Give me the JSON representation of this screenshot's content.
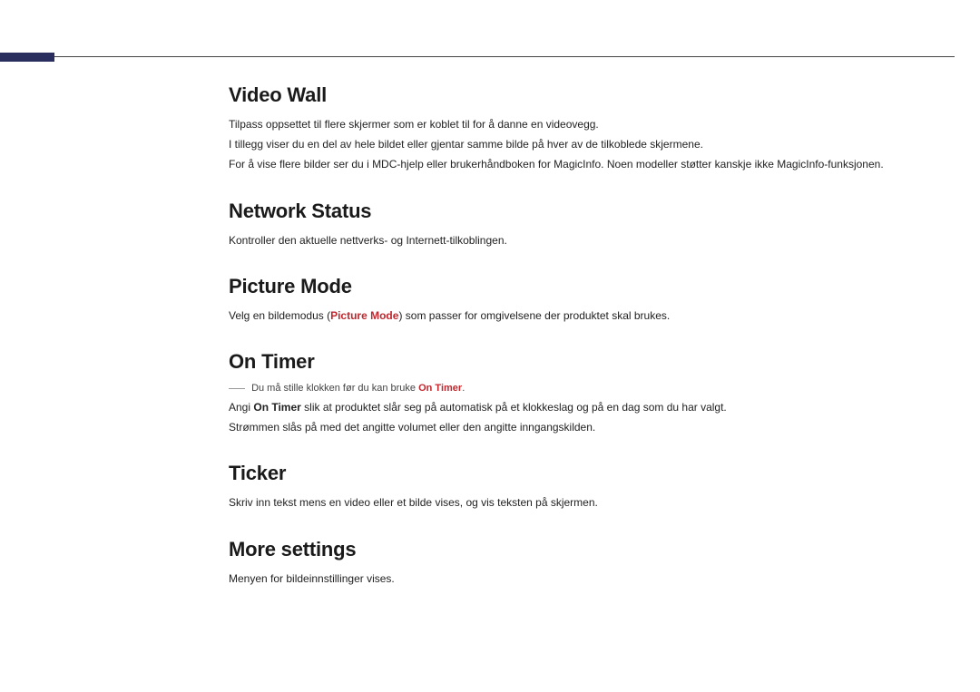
{
  "sections": {
    "videoWall": {
      "heading": "Video Wall",
      "p1": "Tilpass oppsettet til flere skjermer som er koblet til for å danne en videovegg.",
      "p2": "I tillegg viser du en del av hele bildet eller gjentar samme bilde på hver av de tilkoblede skjermene.",
      "p3": "For å vise flere bilder ser du i MDC-hjelp eller brukerhåndboken for MagicInfo. Noen modeller støtter kanskje ikke MagicInfo-funksjonen."
    },
    "networkStatus": {
      "heading": "Network Status",
      "p1": "Kontroller den aktuelle nettverks- og Internett-tilkoblingen."
    },
    "pictureMode": {
      "heading": "Picture Mode",
      "lead": "Velg en bildemodus (",
      "accent": "Picture Mode",
      "tail": ") som passer for omgivelsene der produktet skal brukes."
    },
    "onTimer": {
      "heading": "On Timer",
      "noteLead": "Du må stille klokken før du kan bruke ",
      "noteAccent": "On Timer",
      "noteTail": ".",
      "p1Lead": "Angi ",
      "p1Bold": "On Timer",
      "p1Tail": " slik at produktet slår seg på automatisk på et klokkeslag og på en dag som du har valgt.",
      "p2": "Strømmen slås på med det angitte volumet eller den angitte inngangskilden."
    },
    "ticker": {
      "heading": "Ticker",
      "p1": "Skriv inn tekst mens en video eller et bilde vises, og vis teksten på skjermen."
    },
    "moreSettings": {
      "heading": "More settings",
      "p1": "Menyen for bildeinnstillinger vises."
    }
  }
}
